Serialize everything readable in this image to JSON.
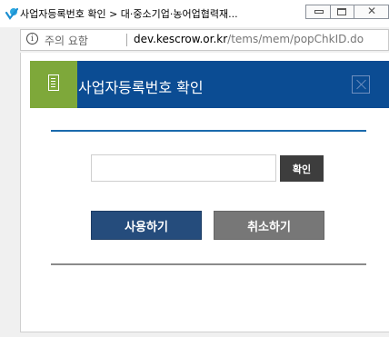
{
  "window": {
    "title": "사업자등록번호 확인 > 대·중소기업·농어업협력재...",
    "icon": "ie-browser-icon",
    "controls": {
      "minimize": "minimize-icon",
      "maximize": "maximize-icon",
      "close": "✕"
    }
  },
  "addressbar": {
    "info_icon_glyph": "i",
    "security_label": "주의 요함",
    "url_domain": "dev.kescrow.or.kr",
    "url_path": "/tems/mem/popChkID.do"
  },
  "popup": {
    "title": "사업자등록번호 확인",
    "header_icon": "document-icon",
    "close_icon": "close-icon",
    "colors": {
      "header_bg": "#0b4c93",
      "icon_box_bg": "#7ea83a",
      "use_button": "#254c7c",
      "cancel_button": "#777777",
      "confirm_button": "#3d3d3d"
    }
  },
  "form": {
    "bizno_value": "",
    "bizno_placeholder": "",
    "confirm_label": "확인"
  },
  "actions": {
    "use_label": "사용하기",
    "cancel_label": "취소하기"
  }
}
